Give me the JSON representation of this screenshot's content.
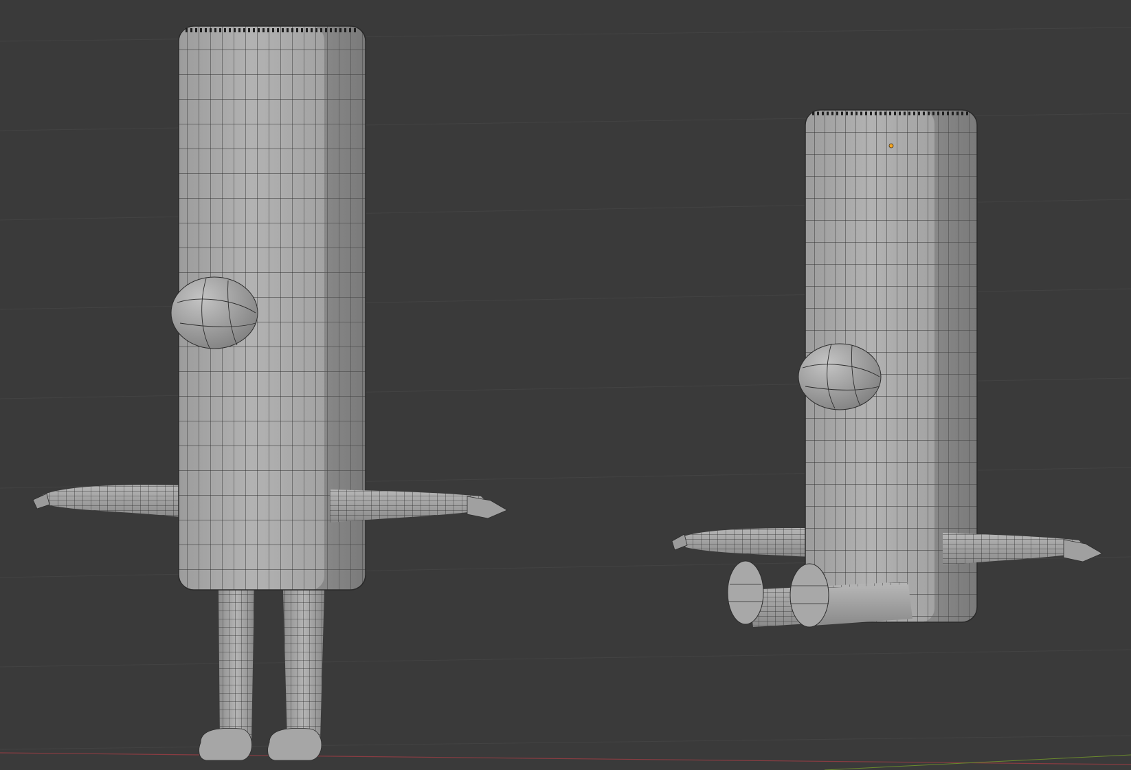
{
  "viewport": {
    "view": "3d-viewport",
    "shading": "solid",
    "overlay": "wireframe",
    "background_color": "#3a3a3a",
    "grid_line_color": "#434343",
    "x_axis_color": "#8a3c42",
    "y_axis_color": "#6b8a2d",
    "mesh_color": "#a9a9a9",
    "wire_color": "#2a2a2a",
    "origin_color": "#f5a623"
  },
  "objects": [
    {
      "name": "character-t-pose",
      "pose": "standing",
      "icon": "mesh-icon"
    },
    {
      "name": "character-sitting",
      "pose": "sitting",
      "icon": "mesh-icon"
    }
  ]
}
